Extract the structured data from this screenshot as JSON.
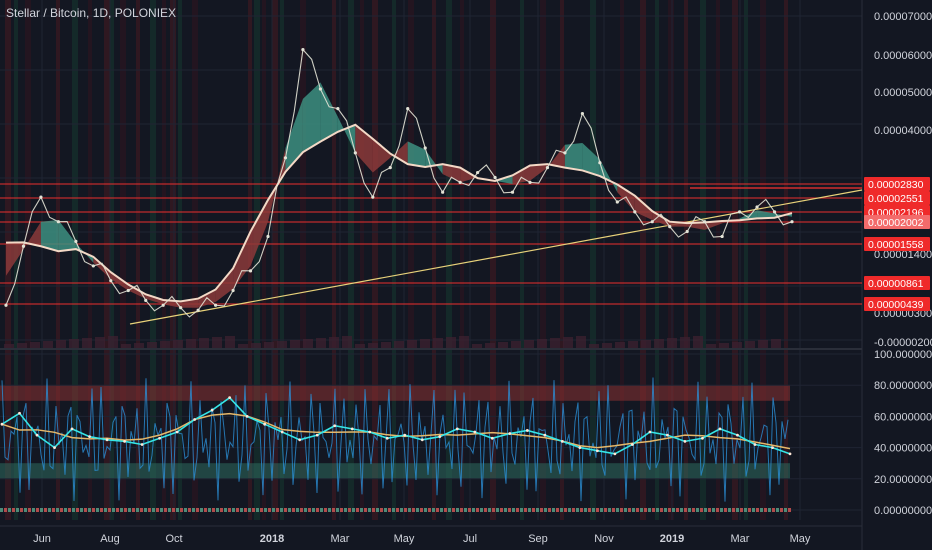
{
  "header": {
    "symbol_title": "Stellar / Bitcoin, 1D, POLONIEX"
  },
  "colors": {
    "background": "#131722",
    "grid": "#1f2433",
    "price_line": "#e3e3d6",
    "trendline": "#e8d27a",
    "level_line": "#d22e2e",
    "level_tag": "#ef2a2a",
    "level_tag_active": "#f36b6b",
    "ribbon_up": "#3d8f80",
    "ribbon_down": "#8b3a3a",
    "rsi_cyan": "#36e6e6",
    "rsi_blue": "#2a8fd6",
    "rsi_white": "#ffe8d8",
    "rsi_band_top": "#8b3232",
    "rsi_band_bottom": "#2e6c5e"
  },
  "chart_data": [
    {
      "type": "line",
      "title": "Stellar / Bitcoin, 1D, POLONIEX",
      "yscale": "linear",
      "ylim": [
        -2e-06,
        7e-06
      ],
      "y_tick_labels": [
        "0.00007000",
        "0.00006000",
        "0.00005000",
        "0.00004000",
        "0.00001400",
        "0.00000300",
        "-0.00000200"
      ],
      "x_tick_labels": [
        "Jun",
        "Aug",
        "Oct",
        "2018",
        "Mar",
        "May",
        "Jul",
        "Sep",
        "Nov",
        "2019",
        "Mar",
        "May"
      ],
      "horizontal_levels": [
        {
          "label": "0.00002830",
          "value": 2.83e-05
        },
        {
          "label": "0.00002551",
          "value": 2.551e-05
        },
        {
          "label": "0.00002196",
          "value": 2.196e-05
        },
        {
          "label": "0.00002002",
          "value": 2.002e-05
        },
        {
          "label": "0.00001558",
          "value": 1.558e-05
        },
        {
          "label": "0.00000861",
          "value": 8.61e-06
        },
        {
          "label": "0.00000439",
          "value": 4.39e-06
        }
      ],
      "series": [
        {
          "values": [
            0.6,
            1.8,
            2.8,
            2.3,
            1.9,
            1.4,
            1.1,
            0.9,
            0.7,
            0.6,
            0.55,
            0.5,
            0.6,
            0.9,
            1.3,
            2.0,
            3.6,
            5.8,
            5.0,
            4.6,
            3.7,
            2.8,
            3.4,
            4.6,
            3.8,
            2.9,
            3.1,
            3.3,
            3.2,
            2.9,
            3.1,
            3.4,
            3.7,
            4.5,
            3.5,
            2.7,
            2.5,
            2.3,
            2.2,
            2.1,
            2.3,
            2.0,
            2.5,
            2.6,
            2.5,
            2.3
          ],
          "unit": "relative price"
        }
      ]
    },
    {
      "type": "line",
      "yscale": "linear",
      "ylim": [
        0,
        100
      ],
      "y_tick_labels": [
        "100.00000000",
        "80.00000000",
        "60.00000000",
        "40.00000000",
        "20.00000000",
        "0.00000000"
      ],
      "bands": [
        [
          70,
          80
        ],
        [
          20,
          30
        ]
      ],
      "series": [
        {
          "values": [
            55,
            62,
            48,
            40,
            52,
            47,
            45,
            44,
            42,
            46,
            50,
            58,
            64,
            72,
            60,
            55,
            50,
            45,
            48,
            54,
            52,
            50,
            46,
            48,
            45,
            47,
            52,
            50,
            46,
            49,
            51,
            48,
            44,
            40,
            38,
            36,
            42,
            50,
            48,
            44,
            46,
            52,
            48,
            42,
            40,
            36
          ]
        }
      ]
    }
  ]
}
